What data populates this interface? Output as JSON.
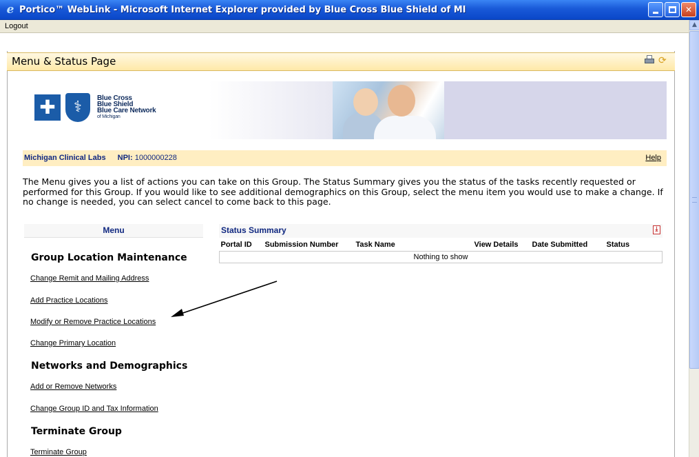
{
  "window": {
    "title": "Portico™ WebLink - Microsoft Internet Explorer provided by Blue Cross Blue Shield of MI",
    "icon": "ie-icon",
    "buttons": [
      "minimize",
      "maximize",
      "close"
    ]
  },
  "toolbar": {
    "logout_label": "Logout"
  },
  "page": {
    "title": "Menu & Status Page",
    "icons": [
      "printer-icon",
      "refresh-icon"
    ]
  },
  "banner": {
    "logo_line1": "Blue Cross",
    "logo_line2": "Blue Shield",
    "logo_line3": "Blue Care Network",
    "logo_line4": "of Michigan"
  },
  "provider": {
    "name": "Michigan Clinical Labs",
    "npi_label": "NPI:",
    "npi_value": "1000000228",
    "help_label": "Help"
  },
  "intro_text": "The Menu gives you a list of actions you can take on this Group. The Status Summary gives you the status of the tasks recently requested or performed for this Group. If you would like to see additional demographics on this Group, select the menu item you would use to make a change. If no change is needed, you can select cancel to come back to this page.",
  "menu": {
    "heading": "Menu",
    "sections": [
      {
        "title": "Group Location Maintenance",
        "items": [
          "Change Remit and Mailing Address",
          "Add Practice Locations",
          "Modify or Remove Practice Locations",
          "Change Primary Location"
        ]
      },
      {
        "title": "Networks and Demographics",
        "items": [
          "Add or Remove Networks",
          "Change Group ID and Tax Information"
        ]
      },
      {
        "title": "Terminate Group",
        "items": [
          "Terminate Group"
        ]
      }
    ]
  },
  "status_summary": {
    "title": "Status Summary",
    "columns": [
      "Portal ID",
      "Submission Number",
      "Task Name",
      "View Details",
      "Date Submitted",
      "Status"
    ],
    "empty_message": "Nothing to show"
  },
  "colors": {
    "header_gold": "#ffe9a8",
    "provider_bar": "#ffeec2",
    "link_navy": "#102880",
    "xp_title_blue": "#1959d8"
  }
}
